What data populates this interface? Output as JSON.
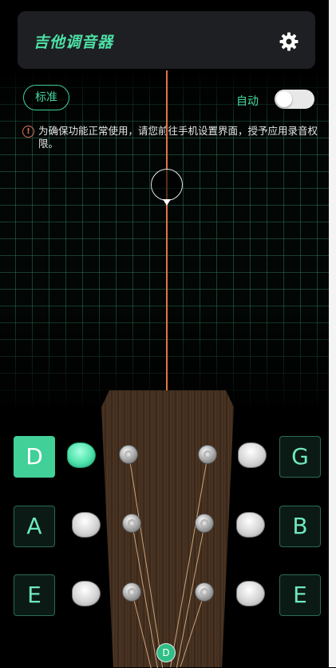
{
  "app": {
    "title": "吉他调音器"
  },
  "icons": {
    "settings": "gear-icon",
    "warning": "alert-circle-icon"
  },
  "tuning": {
    "mode_label": "标准"
  },
  "auto": {
    "label": "自动",
    "enabled": false
  },
  "warning": {
    "symbol": "!",
    "text": "为确保功能正常使用，请您前往手机设置界面，授予应用录音权限。"
  },
  "strings": {
    "left": [
      "D",
      "A",
      "E"
    ],
    "right": [
      "G",
      "B",
      "E"
    ],
    "selected": "D"
  },
  "current_note": "D",
  "colors": {
    "accent": "#41d098",
    "needle": "#e2763f",
    "warning": "#e07060",
    "header_bg": "#1e1f22"
  }
}
